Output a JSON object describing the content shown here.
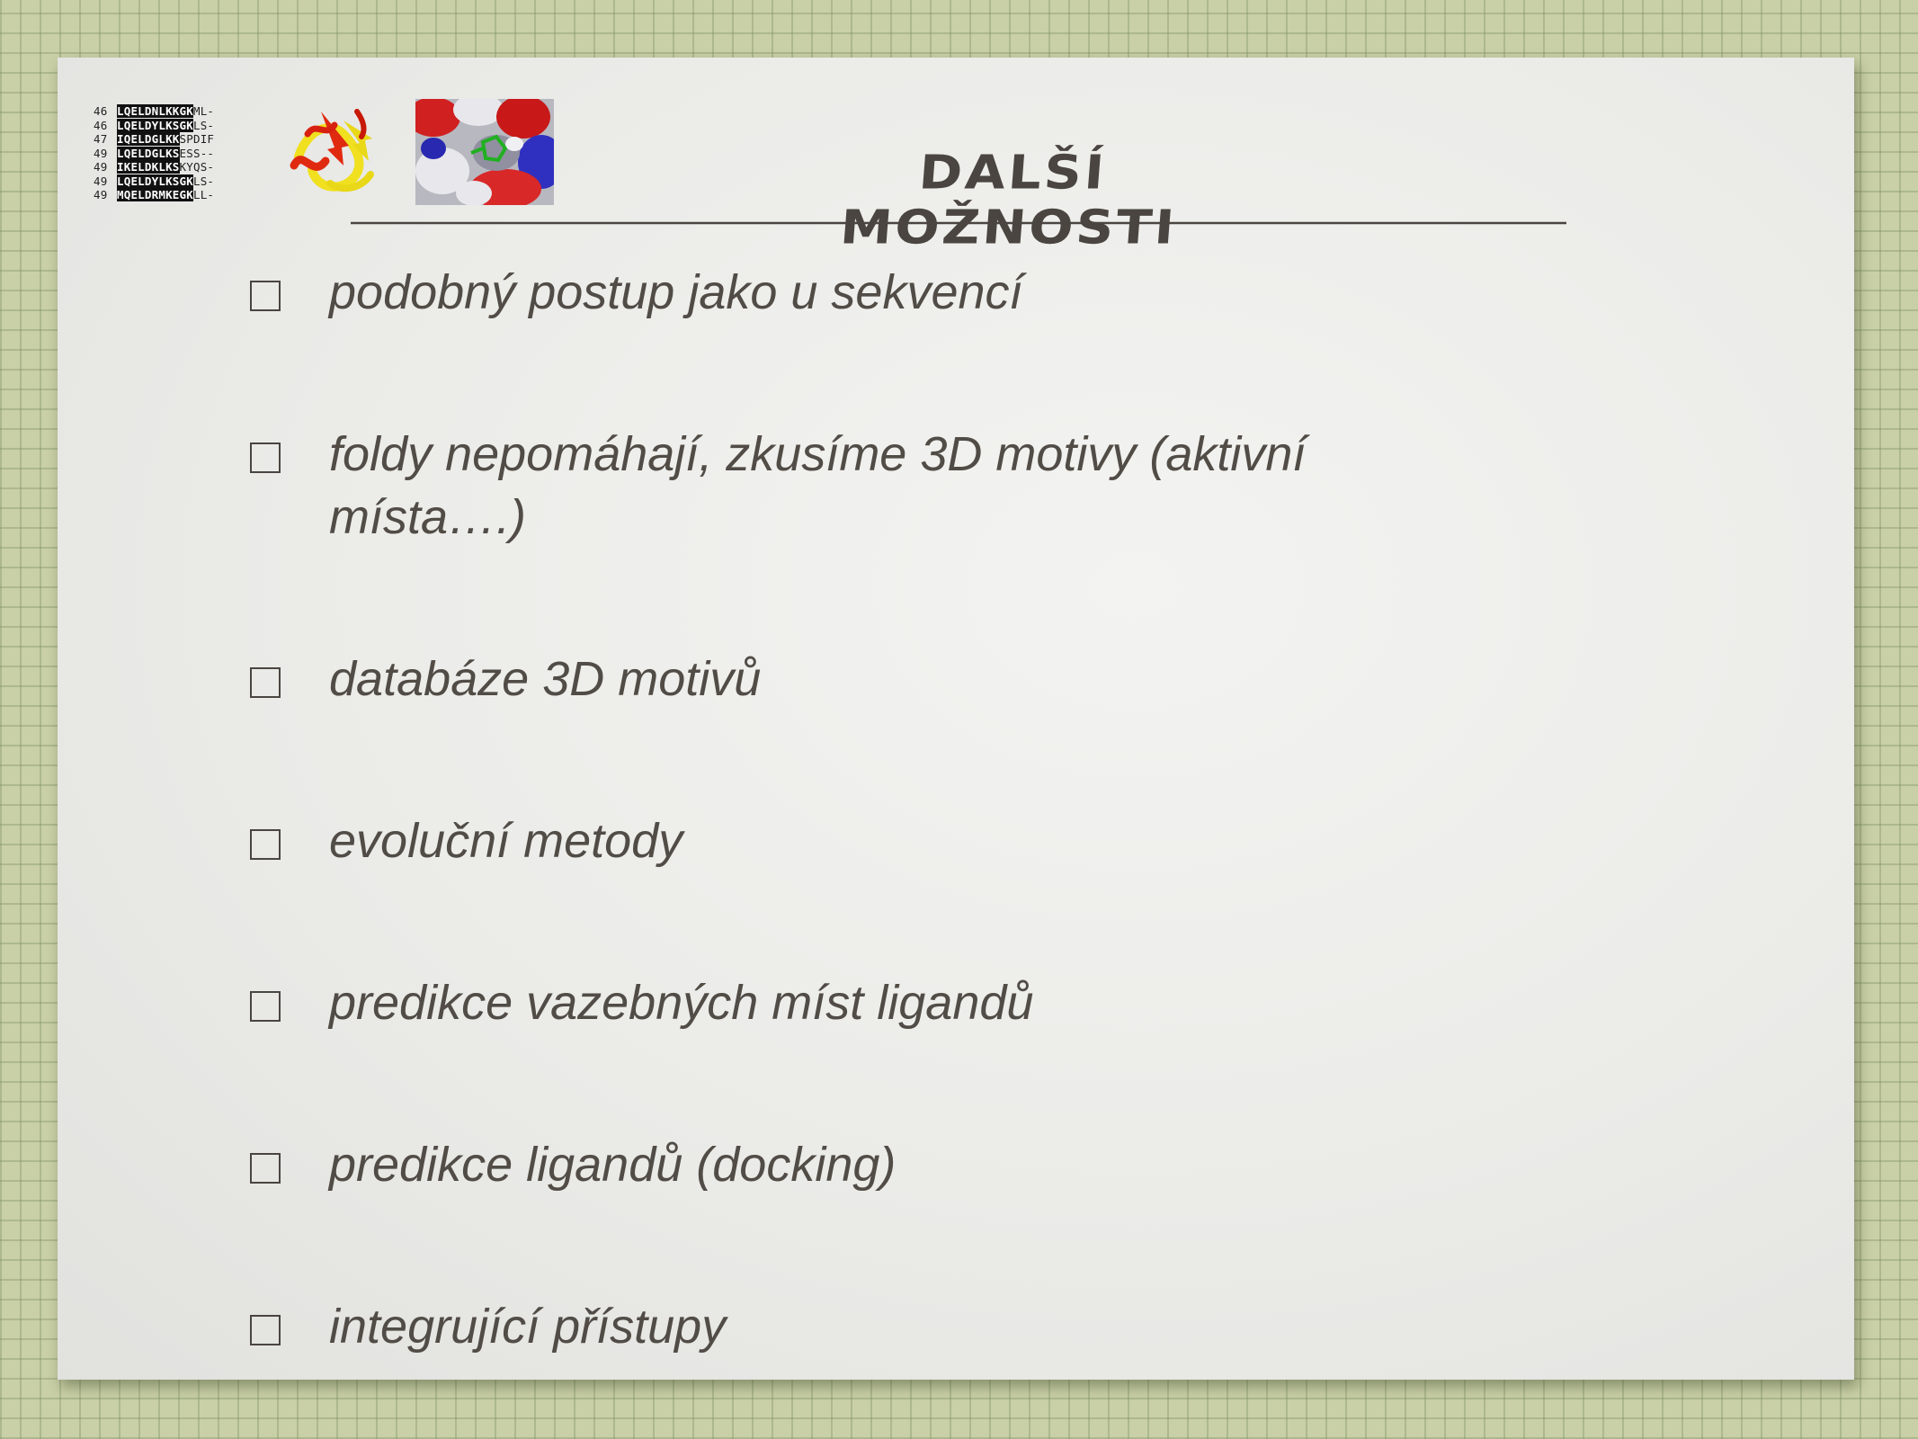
{
  "title": "DALŠÍ MOŽNOSTI",
  "alignment_logo": [
    {
      "num": "46",
      "seq_black": "LQELDNLKKGK",
      "seq_rest": "ML-"
    },
    {
      "num": "46",
      "seq_black": "LQELDYLKSGK",
      "seq_rest": "LS-"
    },
    {
      "num": "47",
      "seq_black": "IQELDGLKK",
      "seq_rest": "SPDIF"
    },
    {
      "num": "49",
      "seq_black": "LQELDGLKS",
      "seq_rest": "ESS--"
    },
    {
      "num": "49",
      "seq_black": "IKELDKLKS",
      "seq_rest": "KYQS-"
    },
    {
      "num": "49",
      "seq_black": "LQELDYLKSGK",
      "seq_rest": "LS-"
    },
    {
      "num": "49",
      "seq_black": "MQELDRMKEGK",
      "seq_rest": "LL-"
    }
  ],
  "bullets": [
    "podobný postup jako u sekvencí",
    "foldy nepomáhají, zkusíme 3D motivy (aktivní místa….)",
    "databáze 3D motivů",
    "evoluční metody",
    "predikce vazebných míst ligandů",
    "predikce ligandů (docking)",
    "integrující přístupy"
  ],
  "colors": {
    "background": "#c9cfa6",
    "slide": "#ebebe8",
    "text": "#514c46",
    "title": "#4a4540"
  }
}
